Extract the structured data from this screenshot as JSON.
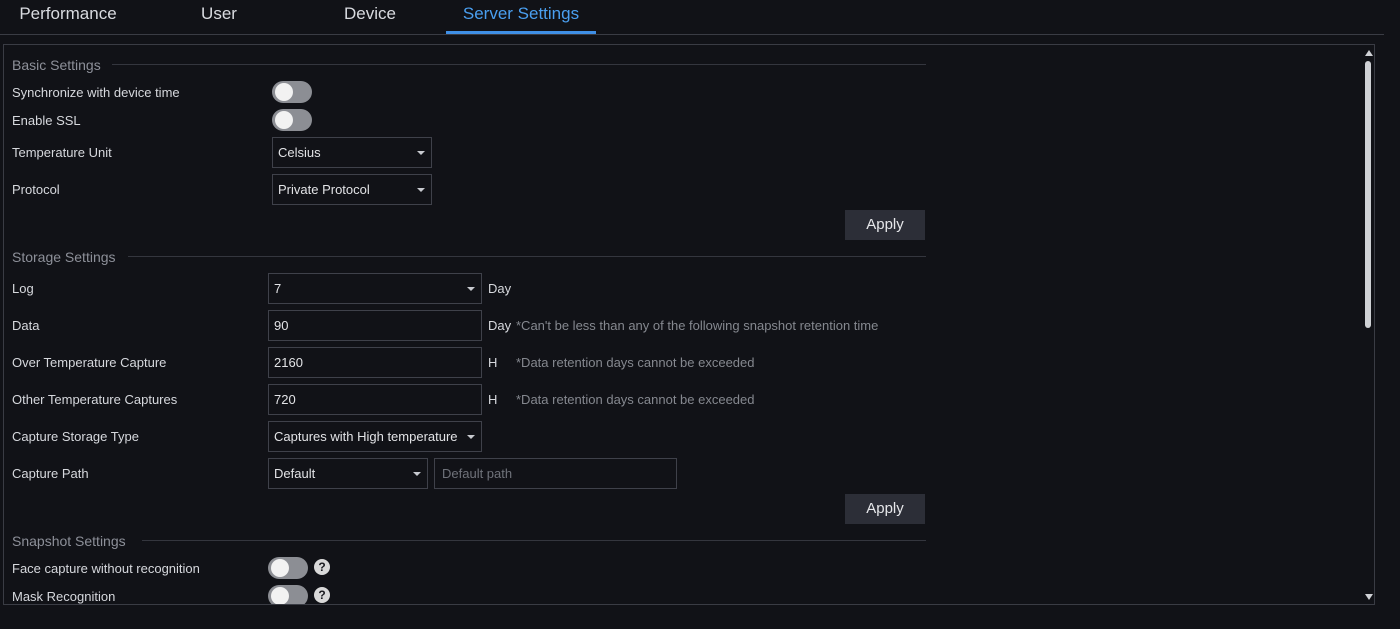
{
  "tabs": [
    {
      "label": "Performance",
      "active": false
    },
    {
      "label": "User",
      "active": false
    },
    {
      "label": "Device",
      "active": false
    },
    {
      "label": "Server Settings",
      "active": true
    }
  ],
  "basic": {
    "title": "Basic Settings",
    "sync_label": "Synchronize with device time",
    "sync_on": false,
    "ssl_label": "Enable SSL",
    "ssl_on": false,
    "temp_unit_label": "Temperature Unit",
    "temp_unit_value": "Celsius",
    "protocol_label": "Protocol",
    "protocol_value": "Private Protocol",
    "apply": "Apply"
  },
  "storage": {
    "title": "Storage Settings",
    "log_label": "Log",
    "log_value": "7",
    "log_unit": "Day",
    "data_label": "Data",
    "data_value": "90",
    "data_unit": "Day",
    "data_note": "*Can't be less than any of the following snapshot retention time",
    "over_temp_label": "Over Temperature Capture",
    "over_temp_value": "2160",
    "over_temp_unit": "H",
    "over_temp_note": "*Data retention days cannot be exceeded",
    "other_temp_label": "Other Temperature Captures",
    "other_temp_value": "720",
    "other_temp_unit": "H",
    "other_temp_note": "*Data retention days cannot be exceeded",
    "storage_type_label": "Capture Storage Type",
    "storage_type_value": "Captures with High temperature",
    "path_label": "Capture Path",
    "path_value": "Default",
    "path_placeholder": "Default path",
    "apply": "Apply"
  },
  "snapshot": {
    "title": "Snapshot Settings",
    "face_label": "Face capture without recognition",
    "face_on": false,
    "mask_label": "Mask Recognition",
    "mask_on": false,
    "help_glyph": "?"
  },
  "colors": {
    "accent": "#3f8fe6",
    "background": "#111217",
    "button": "#2c2e37",
    "toggle_off": "#8c8e94"
  }
}
